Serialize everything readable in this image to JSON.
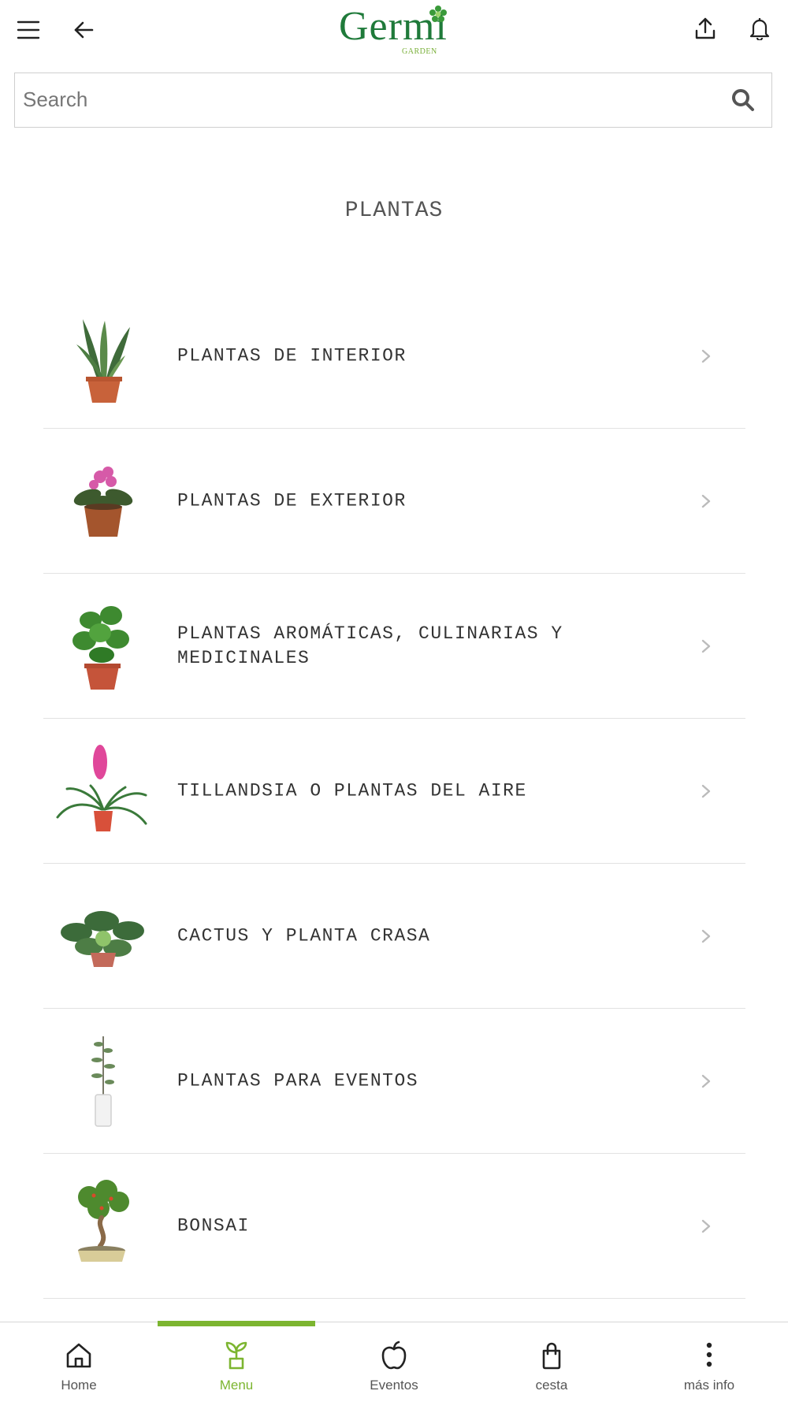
{
  "header": {
    "logo_text": "Germi",
    "logo_subtext": "GARDEN",
    "icons": [
      "menu-icon",
      "back-arrow-icon",
      "share-upload-icon",
      "bell-icon"
    ]
  },
  "search": {
    "placeholder": "Search"
  },
  "page_title": "PLANTAS",
  "categories": [
    {
      "label": "PLANTAS DE INTERIOR",
      "image": "snake-plant-thumbnail"
    },
    {
      "label": "PLANTAS DE EXTERIOR",
      "image": "flowering-plant-thumbnail"
    },
    {
      "label": "PLANTAS AROMÁTICAS, CULINARIAS Y MEDICINALES",
      "image": "basil-plant-thumbnail"
    },
    {
      "label": "TILLANDSIA O PLANTAS DEL AIRE",
      "image": "bromeliad-thumbnail"
    },
    {
      "label": "CACTUS Y PLANTA CRASA",
      "image": "succulent-thumbnail"
    },
    {
      "label": "PLANTAS PARA EVENTOS",
      "image": "sapling-thumbnail"
    },
    {
      "label": "BONSAI",
      "image": "bonsai-thumbnail"
    }
  ],
  "bottom_nav": {
    "items": [
      {
        "label": "Home",
        "icon": "home-icon"
      },
      {
        "label": "Menu",
        "icon": "sprout-icon"
      },
      {
        "label": "Eventos",
        "icon": "apple-icon"
      },
      {
        "label": "cesta",
        "icon": "shopping-bag-icon"
      },
      {
        "label": "más info",
        "icon": "more-vertical-icon"
      }
    ],
    "active_index": 1
  },
  "colors": {
    "accent": "#7cb530",
    "brand_green": "#1f7a3a",
    "divider": "#e2e2e2"
  }
}
